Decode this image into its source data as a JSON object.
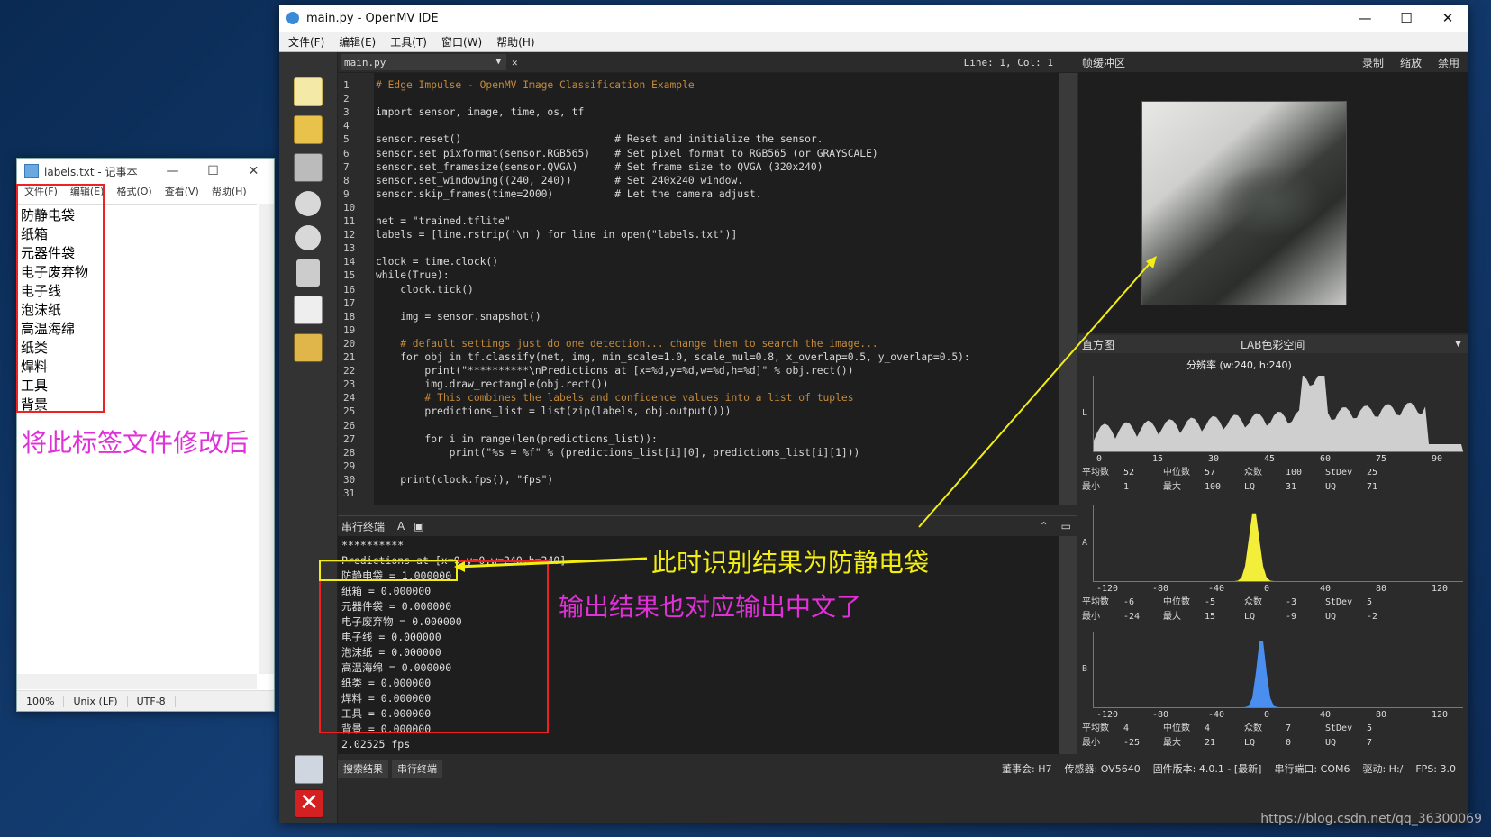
{
  "notepad": {
    "title": "labels.txt - 记事本",
    "menu": [
      "文件(F)",
      "编辑(E)",
      "格式(O)",
      "查看(V)",
      "帮助(H)"
    ],
    "lines": [
      "防静电袋",
      "纸箱",
      "元器件袋",
      "电子废弃物",
      "电子线",
      "泡沫纸",
      "高温海绵",
      "纸类",
      "焊料",
      "工具",
      "背景"
    ],
    "status": [
      "100%",
      "Unix (LF)",
      "UTF-8"
    ]
  },
  "annotations": {
    "modify_label": "将此标签文件修改后",
    "result_label": "此时识别结果为防静电袋",
    "output_label": "输出结果也对应输出中文了"
  },
  "ide": {
    "title": "main.py - OpenMV IDE",
    "menu": [
      "文件(F)",
      "编辑(E)",
      "工具(T)",
      "窗口(W)",
      "帮助(H)"
    ],
    "file_tab": "main.py",
    "line_col": "Line: 1, Col: 1",
    "code_lines": [
      "# Edge Impulse - OpenMV Image Classification Example",
      "",
      "import sensor, image, time, os, tf",
      "",
      "sensor.reset()                         # Reset and initialize the sensor.",
      "sensor.set_pixformat(sensor.RGB565)    # Set pixel format to RGB565 (or GRAYSCALE)",
      "sensor.set_framesize(sensor.QVGA)      # Set frame size to QVGA (320x240)",
      "sensor.set_windowing((240, 240))       # Set 240x240 window.",
      "sensor.skip_frames(time=2000)          # Let the camera adjust.",
      "",
      "net = \"trained.tflite\"",
      "labels = [line.rstrip('\\n') for line in open(\"labels.txt\")]",
      "",
      "clock = time.clock()",
      "while(True):",
      "    clock.tick()",
      "",
      "    img = sensor.snapshot()",
      "",
      "    # default settings just do one detection... change them to search the image...",
      "    for obj in tf.classify(net, img, min_scale=1.0, scale_mul=0.8, x_overlap=0.5, y_overlap=0.5):",
      "        print(\"**********\\nPredictions at [x=%d,y=%d,w=%d,h=%d]\" % obj.rect())",
      "        img.draw_rectangle(obj.rect())",
      "        # This combines the labels and confidence values into a list of tuples",
      "        predictions_list = list(zip(labels, obj.output()))",
      "",
      "        for i in range(len(predictions_list)):",
      "            print(\"%s = %f\" % (predictions_list[i][0], predictions_list[i][1]))",
      "",
      "    print(clock.fps(), \"fps\")",
      ""
    ],
    "terminal_title": "串行终端",
    "terminal_lines": [
      "**********",
      "Predictions at [x=0,y=0,w=240,h=240]",
      "防静电袋 = 1.000000",
      "纸箱 = 0.000000",
      "元器件袋 = 0.000000",
      "电子废弃物 = 0.000000",
      "电子线 = 0.000000",
      "泡沫纸 = 0.000000",
      "高温海绵 = 0.000000",
      "纸类 = 0.000000",
      "焊料 = 0.000000",
      "工具 = 0.000000",
      "背景 = 0.000000",
      "2.02525 fps"
    ],
    "status_tabs": [
      "搜索结果",
      "串行终端"
    ],
    "status": {
      "board": "董事会: H7",
      "sensor": "传感器: OV5640",
      "firmware": "固件版本: 4.0.1 - [最新]",
      "port": "串行端口: COM6",
      "drive": "驱动: H:/",
      "fps": "FPS: 3.0"
    },
    "framebuffer": {
      "title": "帧缓冲区",
      "buttons": [
        "录制",
        "缩放",
        "禁用"
      ]
    },
    "histogram": {
      "title": "直方图",
      "colorspace": "LAB色彩空间",
      "resolution": "分辨率 (w:240, h:240)",
      "channels": [
        {
          "axis": "L",
          "ticks": [
            "0",
            "15",
            "30",
            "45",
            "60",
            "75",
            "90"
          ],
          "stats": [
            [
              "平均数",
              "52",
              "中位数",
              "57",
              "众数",
              "100",
              "StDev",
              "25"
            ],
            [
              "最小",
              "1",
              "最大",
              "100",
              "LQ",
              "31",
              "UQ",
              "71"
            ]
          ]
        },
        {
          "axis": "A",
          "ticks": [
            "-120",
            "-80",
            "-40",
            "0",
            "40",
            "80",
            "120"
          ],
          "stats": [
            [
              "平均数",
              "-6",
              "中位数",
              "-5",
              "众数",
              "-3",
              "StDev",
              "5"
            ],
            [
              "最小",
              "-24",
              "最大",
              "15",
              "LQ",
              "-9",
              "UQ",
              "-2"
            ]
          ]
        },
        {
          "axis": "B",
          "ticks": [
            "-120",
            "-80",
            "-40",
            "0",
            "40",
            "80",
            "120"
          ],
          "stats": [
            [
              "平均数",
              "4",
              "中位数",
              "4",
              "众数",
              "7",
              "StDev",
              "5"
            ],
            [
              "最小",
              "-25",
              "最大",
              "21",
              "LQ",
              "0",
              "UQ",
              "7"
            ]
          ]
        }
      ]
    }
  },
  "watermark": "https://blog.csdn.net/qq_36300069"
}
